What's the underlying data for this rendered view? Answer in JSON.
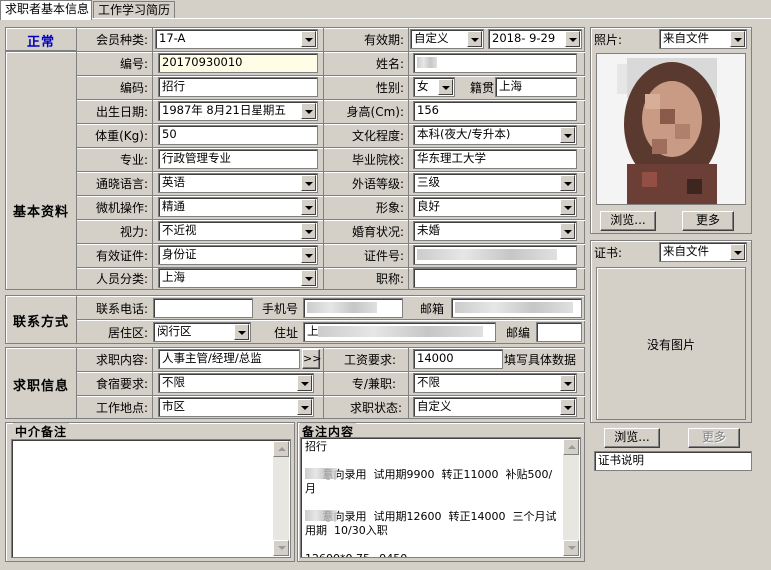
{
  "tabs": [
    "求职者基本信息",
    "工作学习简历"
  ],
  "status": "正常",
  "groups": {
    "basic": "基本资料",
    "contact": "联系方式",
    "job": "求职信息"
  },
  "labels": {
    "member_type": "会员种类:",
    "validity": "有效期:",
    "number": "编号:",
    "name": "姓名:",
    "code": "编码:",
    "gender": "性别:",
    "origin": "籍贯",
    "birth": "出生日期:",
    "height": "身高(Cm):",
    "weight": "体重(Kg):",
    "education": "文化程度:",
    "major": "专业:",
    "school": "毕业院校:",
    "language": "通晓语言:",
    "lang_level": "外语等级:",
    "computer": "微机操作:",
    "appearance": "形象:",
    "vision": "视力:",
    "marital": "婚育状况:",
    "id_type": "有效证件:",
    "id_no": "证件号:",
    "category": "人员分类:",
    "title": "职称:",
    "phone": "联系电话:",
    "mobile": "手机号",
    "email": "邮箱",
    "district": "居住区:",
    "address": "住址",
    "postcode": "邮编",
    "job_content": "求职内容:",
    "salary": "工资要求:",
    "lodging": "食宿要求:",
    "fulltime": "专/兼职:",
    "location": "工作地点:",
    "job_status": "求职状态:",
    "photo": "照片:",
    "cert": "证书:"
  },
  "values": {
    "member_type": "17-A",
    "validity_type": "自定义",
    "validity_date": "2018- 9-29",
    "number": "20170930010",
    "code": "招行",
    "gender": "女",
    "origin": "上海",
    "birth": "1987年 8月21日星期五",
    "height": "156",
    "weight": "50",
    "education": "本科(夜大/专升本)",
    "major": "行政管理专业",
    "school": "华东理工大学",
    "language": "英语",
    "lang_level": "三级",
    "computer": "精通",
    "appearance": "良好",
    "vision": "不近视",
    "marital": "未婚",
    "id_type": "身份证",
    "category": "上海",
    "district": "闵行区",
    "address_prefix": "上",
    "job_content": "人事主管/经理/总监",
    "salary": "14000",
    "salary_note": "填写具体数据",
    "lodging": "不限",
    "fulltime": "不限",
    "location": "市区",
    "job_status": "自定义",
    "photo_source": "来自文件",
    "cert_source": "来自文件",
    "cert_desc": "证书说明"
  },
  "buttons": {
    "browse": "浏览...",
    "more": "更多",
    "browse2": "浏览...",
    "more2": "更多",
    "expand": ">>"
  },
  "no_image": "没有图片",
  "agent_notes_title": "中介备注",
  "remarks_title": "备注内容",
  "remarks_text": "招行\n\n     意向录用  试用期9900  转正11000  补贴500/月\n\n     意向录用  试用期12600  转正14000  三个月试用期  10/30入职\n\n12600*0.75=9450"
}
